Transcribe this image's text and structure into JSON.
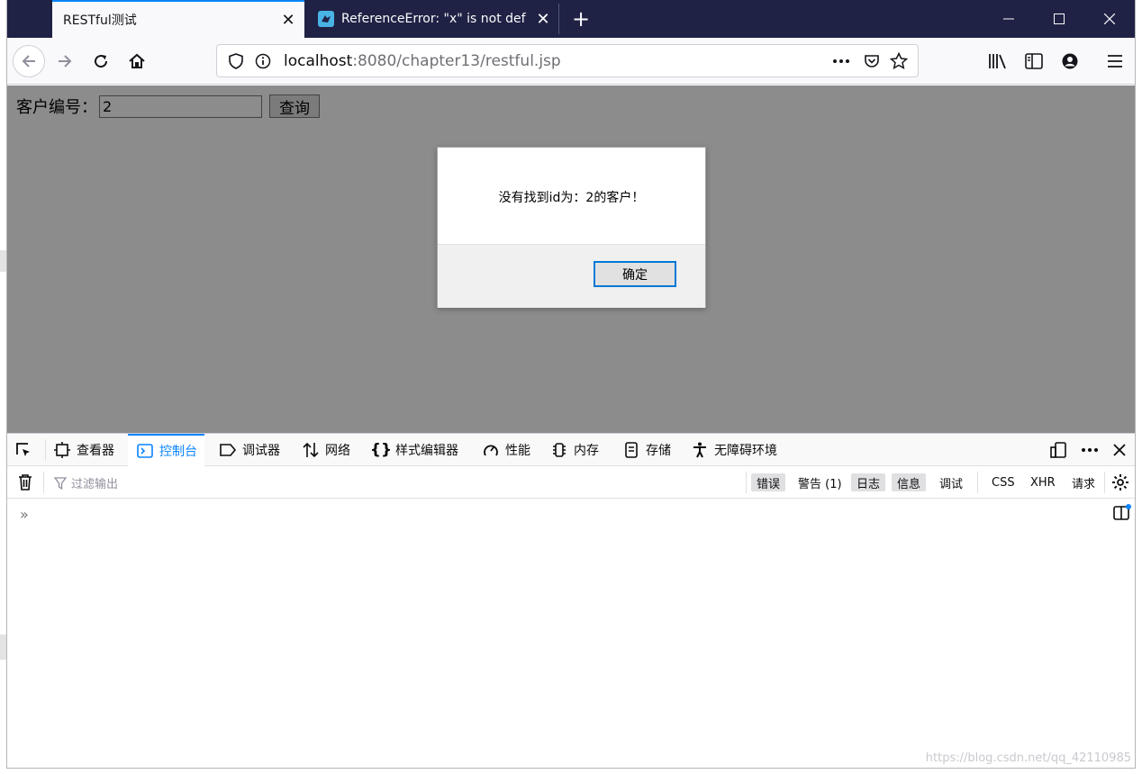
{
  "browser": {
    "tabs": [
      {
        "title": "RESTful测试",
        "active": true
      },
      {
        "title": "ReferenceError: \"x\" is not def",
        "active": false
      }
    ],
    "tab_close_symbol": "✕",
    "new_tab_symbol": "+",
    "url": {
      "host": "localhost",
      "rest": ":8080/chapter13/restful.jsp"
    }
  },
  "page": {
    "label": "客户编号：",
    "input_value": "2",
    "query_button": "查询"
  },
  "dialog": {
    "message": "没有找到id为：2的客户！",
    "ok_label": "确定"
  },
  "devtools": {
    "tabs": [
      {
        "label": "查看器",
        "icon": "inspector-icon"
      },
      {
        "label": "控制台",
        "icon": "console-icon",
        "selected": true
      },
      {
        "label": "调试器",
        "icon": "debugger-icon"
      },
      {
        "label": "网络",
        "icon": "network-icon"
      },
      {
        "label": "样式编辑器",
        "icon": "style-editor-icon"
      },
      {
        "label": "性能",
        "icon": "performance-icon"
      },
      {
        "label": "内存",
        "icon": "memory-icon"
      },
      {
        "label": "存储",
        "icon": "storage-icon"
      },
      {
        "label": "无障碍环境",
        "icon": "accessibility-icon"
      }
    ],
    "filter_placeholder": "过滤输出",
    "levels": {
      "error": "错误",
      "warning": "警告 (1)",
      "log": "日志",
      "info": "信息",
      "debug": "调试",
      "css": "CSS",
      "xhr": "XHR",
      "requests": "请求"
    },
    "prompt": "»"
  },
  "watermark": "https://blog.csdn.net/qq_42110985",
  "colors": {
    "tabstrip": "#1f2244",
    "accent": "#0a84ff",
    "overlay": "rgba(0,0,0,0.45)"
  }
}
